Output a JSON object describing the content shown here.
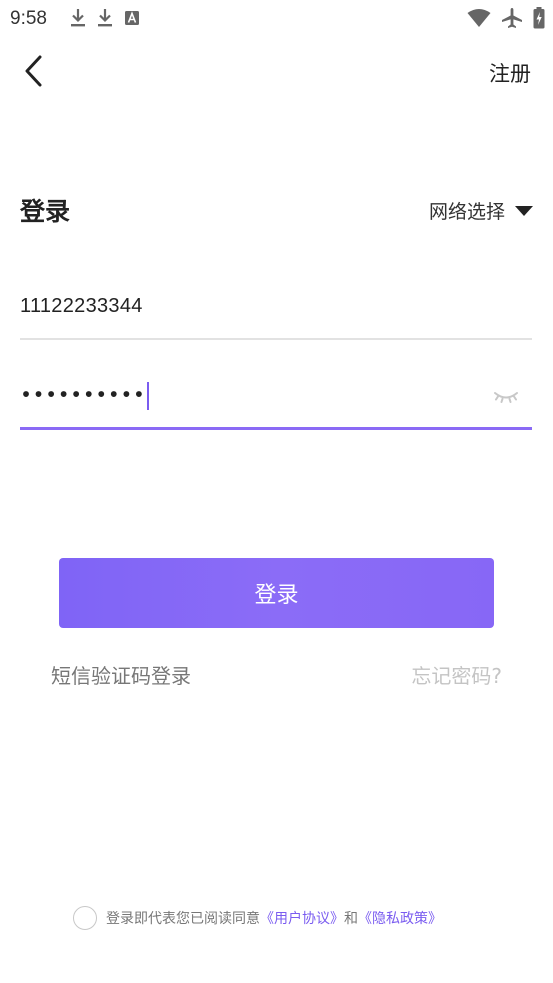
{
  "status_bar": {
    "time": "9:58",
    "left_icons": [
      "download-icon",
      "download-icon",
      "text-a-icon"
    ],
    "right_icons": [
      "wifi-icon",
      "airplane-icon",
      "battery-charging-icon"
    ]
  },
  "header": {
    "back_icon": "chevron-left-icon",
    "register_label": "注册"
  },
  "login_form": {
    "title": "登录",
    "network_select_label": "网络选择",
    "phone_value": "11122233344",
    "password_masked": "••••••••••",
    "visibility_icon": "eye-closed-icon",
    "submit_label": "登录",
    "sms_login_label": "短信验证码登录",
    "forgot_password_label": "忘记密码?"
  },
  "agreement": {
    "prefix": "登录即代表您已阅读同意",
    "user_agreement": "《用户协议》",
    "conjunction": "和",
    "privacy_policy": "《隐私政策》",
    "checked": false
  },
  "colors": {
    "accent": "#8a6af5",
    "button_gradient_start": "#7f64f6",
    "button_gradient_end": "#8767f6",
    "muted_text": "#777777",
    "disabled_text": "#c4c4c4"
  }
}
